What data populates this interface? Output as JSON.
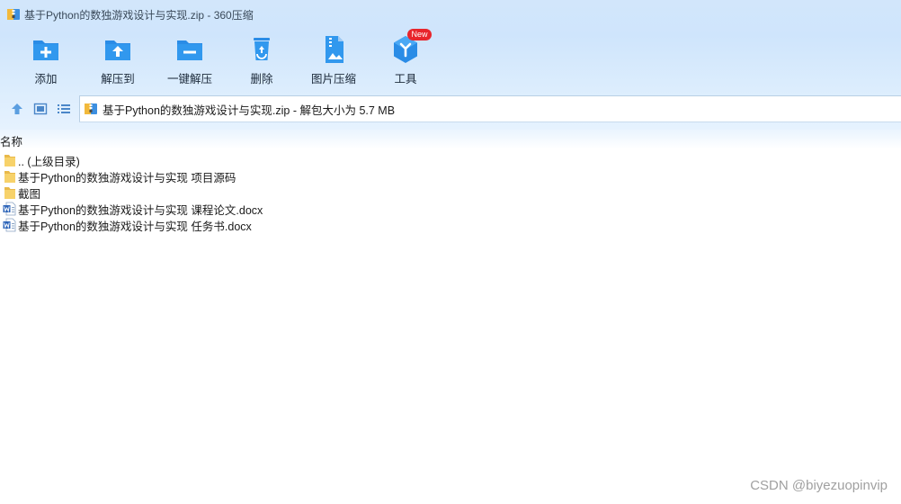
{
  "window": {
    "title": "基于Python的数独游戏设计与实现.zip - 360压缩",
    "icon": "zip-archive-icon"
  },
  "toolbar": {
    "items": [
      {
        "label": "添加",
        "icon": "add-folder-icon"
      },
      {
        "label": "解压到",
        "icon": "extract-to-folder-icon"
      },
      {
        "label": "一键解压",
        "icon": "one-click-extract-icon"
      },
      {
        "label": "删除",
        "icon": "recycle-bin-icon"
      },
      {
        "label": "图片压缩",
        "icon": "image-compress-icon"
      },
      {
        "label": "工具",
        "icon": "tools-cube-icon",
        "badge": "New"
      }
    ]
  },
  "navigation": {
    "up_icon": "up-arrow-icon",
    "view_icon": "thumbnail-view-icon",
    "list_icon": "list-view-icon",
    "address": "基于Python的数独游戏设计与实现.zip - 解包大小为 5.7 MB"
  },
  "file_list": {
    "header": "名称",
    "rows": [
      {
        "name": ".. (上级目录)",
        "icon": "folder-icon"
      },
      {
        "name": "基于Python的数独游戏设计与实现 项目源码",
        "icon": "folder-icon"
      },
      {
        "name": "截图",
        "icon": "folder-icon"
      },
      {
        "name": "基于Python的数独游戏设计与实现 课程论文.docx",
        "icon": "word-document-icon"
      },
      {
        "name": "基于Python的数独游戏设计与实现 任务书.docx",
        "icon": "word-document-icon"
      }
    ]
  },
  "watermark": "CSDN @biyezuopinvip",
  "colors": {
    "accent_blue": "#2a8ce6",
    "folder_yellow": "#f7d26a",
    "badge_red": "#e8252c",
    "toolbar_background": "#d2e6fb"
  }
}
